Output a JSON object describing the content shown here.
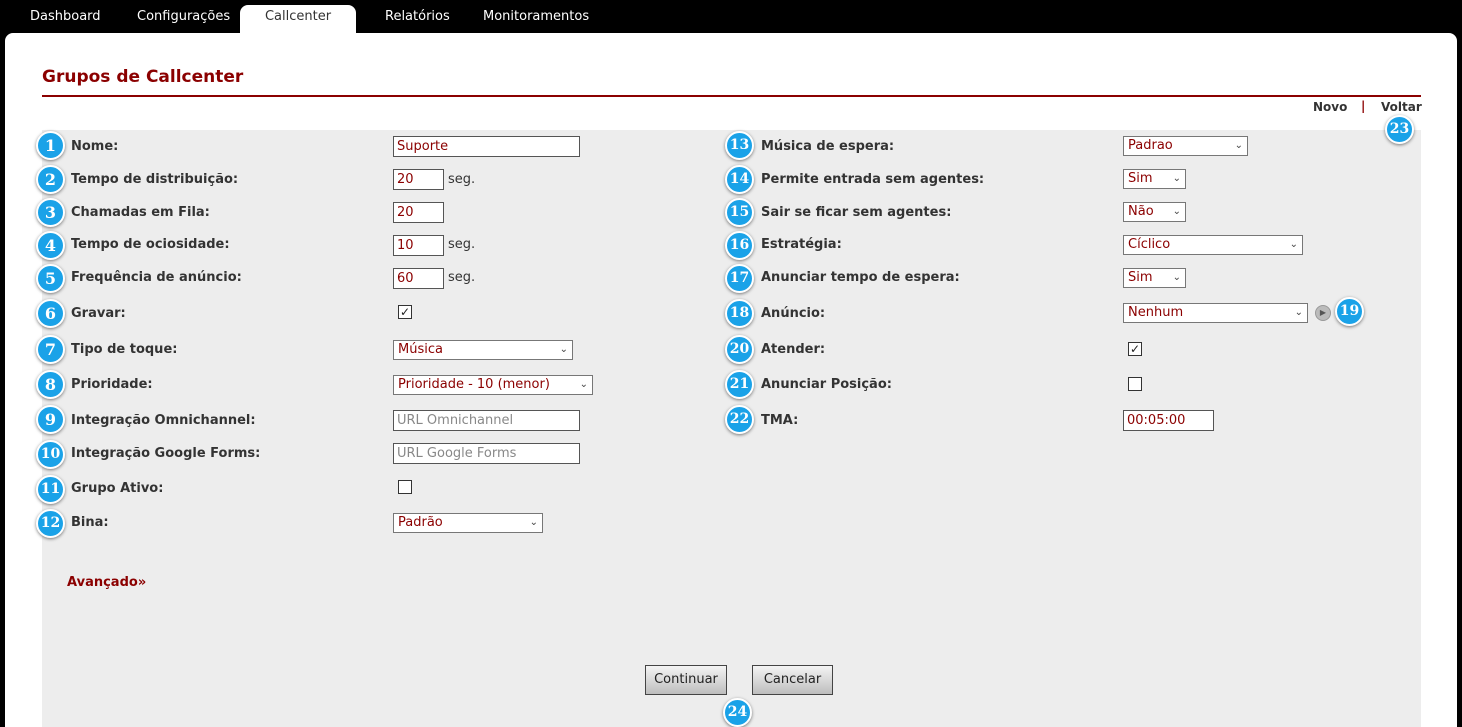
{
  "nav": {
    "tabs": [
      "Dashboard",
      "Configurações",
      "Callcenter",
      "Relatórios",
      "Monitoramentos"
    ],
    "active": "Callcenter"
  },
  "page": {
    "title": "Grupos de Callcenter",
    "links": {
      "novo": "Novo",
      "separator": "|",
      "voltar": "Voltar"
    }
  },
  "left": {
    "nome": {
      "label": "Nome:",
      "value": "Suporte"
    },
    "distribuicao": {
      "label": "Tempo de distribuição:",
      "value": "20",
      "unit": "seg."
    },
    "fila": {
      "label": "Chamadas em Fila:",
      "value": "20"
    },
    "ociosidade": {
      "label": "Tempo de ociosidade:",
      "value": "10",
      "unit": "seg."
    },
    "frequencia": {
      "label": "Frequência de anúncio:",
      "value": "60",
      "unit": "seg."
    },
    "gravar": {
      "label": "Gravar:",
      "checked": true
    },
    "toque": {
      "label": "Tipo de toque:",
      "value": "Música"
    },
    "prioridade": {
      "label": "Prioridade:",
      "value": "Prioridade - 10 (menor)"
    },
    "omni": {
      "label": "Integração Omnichannel:",
      "placeholder": "URL Omnichannel"
    },
    "gforms": {
      "label": "Integração Google Forms:",
      "placeholder": "URL Google Forms"
    },
    "ativo": {
      "label": "Grupo Ativo:",
      "checked": false
    },
    "bina": {
      "label": "Bina:",
      "value": "Padrão"
    }
  },
  "right": {
    "musica": {
      "label": "Música de espera:",
      "value": "Padrao"
    },
    "entrada": {
      "label": "Permite entrada sem agentes:",
      "value": "Sim"
    },
    "sair": {
      "label": "Sair se ficar sem agentes:",
      "value": "Não"
    },
    "estrategia": {
      "label": "Estratégia:",
      "value": "Cíclico"
    },
    "tempo_espera": {
      "label": "Anunciar tempo de espera:",
      "value": "Sim"
    },
    "anuncio": {
      "label": "Anúncio:",
      "value": "Nenhum"
    },
    "atender": {
      "label": "Atender:",
      "checked": true
    },
    "posicao": {
      "label": "Anunciar Posição:",
      "checked": false
    },
    "tma": {
      "label": "TMA:",
      "value": "00:05:00"
    }
  },
  "advanced": {
    "label": "Avançado»"
  },
  "buttons": {
    "continuar": "Continuar",
    "cancelar": "Cancelar"
  },
  "badges": [
    "1",
    "2",
    "3",
    "4",
    "5",
    "6",
    "7",
    "8",
    "9",
    "10",
    "11",
    "12",
    "13",
    "14",
    "15",
    "16",
    "17",
    "18",
    "19",
    "20",
    "21",
    "22",
    "23",
    "24"
  ],
  "icons": {
    "check": "✓",
    "chevron": "chevron-down-icon",
    "play": "play-icon"
  },
  "colors": {
    "accent": "#8b0000",
    "badge": "#1aa2e8",
    "form_bg": "#ededed"
  }
}
